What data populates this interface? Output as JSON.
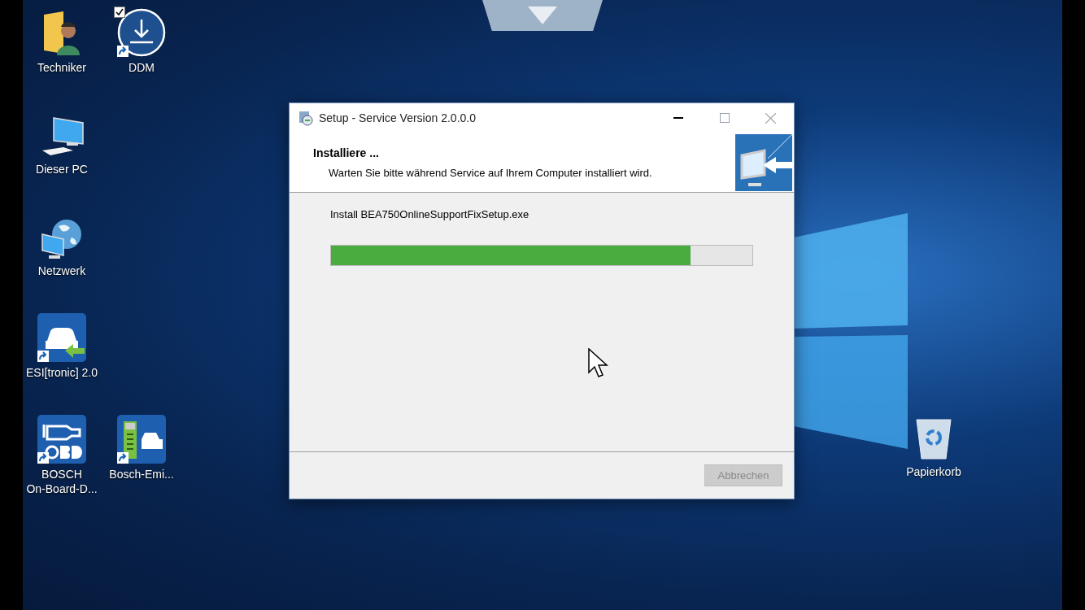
{
  "desktop_icon_rows": [
    [
      {
        "label": "Techniker",
        "kind": "user-folder",
        "shortcut": false,
        "checked": false
      },
      {
        "label": "DDM",
        "kind": "download",
        "shortcut": true,
        "checked": true
      }
    ],
    [
      {
        "label": "Dieser PC",
        "kind": "computer",
        "shortcut": false,
        "checked": false
      }
    ],
    [
      {
        "label": "Netzwerk",
        "kind": "network",
        "shortcut": false,
        "checked": false
      }
    ],
    [
      {
        "label": "ESI[tronic] 2.0",
        "kind": "car-arrow",
        "shortcut": true,
        "checked": false
      }
    ],
    [
      {
        "label": "BOSCH\nOn-Board-D...",
        "kind": "engine",
        "shortcut": true,
        "checked": false
      },
      {
        "label": "Bosch-Emi...",
        "kind": "emission",
        "shortcut": true,
        "checked": false
      }
    ]
  ],
  "recycle_bin": {
    "label": "Papierkorb"
  },
  "dialog": {
    "title": "Setup - Service Version 2.0.0.0",
    "heading": "Installiere ...",
    "subheading": "Warten Sie bitte während Service auf Ihrem Computer installiert wird.",
    "status": "Install BEA750OnlineSupportFixSetup.exe",
    "progress": {
      "level": 0.854
    },
    "cancel_button": {
      "label": "Abbrechen",
      "disabled": true
    }
  }
}
